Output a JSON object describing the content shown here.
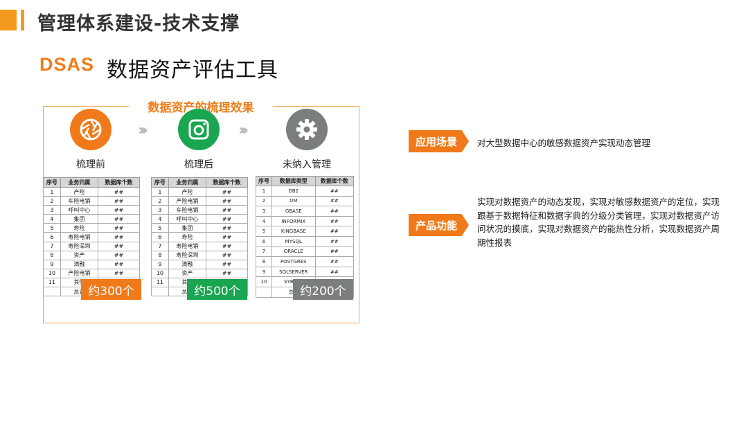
{
  "header": {
    "title": "管理体系建设-技术支撑"
  },
  "subtitle": {
    "brand": "DSAS",
    "text": "数据资产评估工具"
  },
  "panel": {
    "title": "数据资产的梳理效果",
    "stages": [
      {
        "label": "梳理前",
        "icon": "aperture-icon",
        "color": "#f07a19",
        "badge": "约300个"
      },
      {
        "label": "梳理后",
        "icon": "camera-icon",
        "color": "#1aa551",
        "badge": "约500个"
      },
      {
        "label": "未纳入管理",
        "icon": "gear-icon",
        "color": "#7a7f7d",
        "badge": "约200个"
      }
    ],
    "arrows": "›››",
    "table_before": {
      "headers": [
        "序号",
        "业务归属",
        "数据库个数"
      ],
      "rows": [
        [
          "1",
          "产险",
          "##"
        ],
        [
          "2",
          "车险电销",
          "##"
        ],
        [
          "3",
          "呼叫中心",
          "##"
        ],
        [
          "4",
          "集团",
          "##"
        ],
        [
          "5",
          "寿险",
          "##"
        ],
        [
          "6",
          "寿险电销",
          "##"
        ],
        [
          "7",
          "寿险深圳",
          "##"
        ],
        [
          "8",
          "资产",
          "##"
        ],
        [
          "9",
          "滴融",
          "##"
        ],
        [
          "10",
          "产险电销",
          "##"
        ],
        [
          "11",
          "其他",
          "##"
        ],
        [
          "",
          "总计",
          ""
        ]
      ]
    },
    "table_after": {
      "headers": [
        "序号",
        "业务归属",
        "数据库个数"
      ],
      "rows": [
        [
          "1",
          "产险",
          "##"
        ],
        [
          "2",
          "产险电销",
          "##"
        ],
        [
          "3",
          "车险电销",
          "##"
        ],
        [
          "4",
          "呼叫中心",
          "##"
        ],
        [
          "5",
          "集团",
          "##"
        ],
        [
          "6",
          "寿险",
          "##"
        ],
        [
          "7",
          "寿险电销",
          "##"
        ],
        [
          "8",
          "寿险深圳",
          "##"
        ],
        [
          "9",
          "滴融",
          "##"
        ],
        [
          "10",
          "资产",
          "##"
        ],
        [
          "11",
          "其他",
          "##"
        ],
        [
          "",
          "总计",
          ""
        ]
      ]
    },
    "table_unmanaged": {
      "headers": [
        "序号",
        "数据库类型",
        "数据库个数"
      ],
      "rows": [
        [
          "1",
          "DB2",
          "##"
        ],
        [
          "2",
          "DM",
          "##"
        ],
        [
          "3",
          "GBASE",
          "##"
        ],
        [
          "4",
          "INFORMIX",
          "##"
        ],
        [
          "5",
          "KINGBASE",
          "##"
        ],
        [
          "6",
          "MYSQL",
          "##"
        ],
        [
          "7",
          "ORACLE",
          "##"
        ],
        [
          "8",
          "POSTGRES",
          "##"
        ],
        [
          "9",
          "SQLSERVER",
          "##"
        ],
        [
          "10",
          "SYBASE",
          "##"
        ],
        [
          "",
          "总计",
          ""
        ]
      ]
    }
  },
  "sections": [
    {
      "tag": "应用场景",
      "text": "对大型数据中心的敏感数据资产实现动态管理"
    },
    {
      "tag": "产品功能",
      "text": "实现对数据资产的动态发现，实现对敏感数据资产的定位，实现跟基于数据特征和数据字典的分级分类管理，实现对数据资产访问状况的摸底，实现对数据资产的能热性分析，实现数据资产周期性报表"
    }
  ],
  "colors": {
    "accent": "#f07a19",
    "green": "#1aa551",
    "gray": "#7a7f7d"
  }
}
